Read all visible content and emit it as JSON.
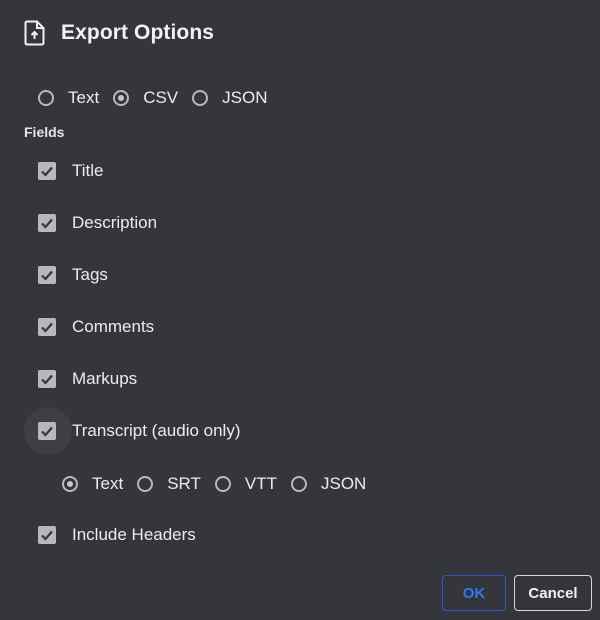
{
  "dialog": {
    "title": "Export Options",
    "title_icon": "file-upload-icon"
  },
  "format": {
    "options": [
      "Text",
      "CSV",
      "JSON"
    ],
    "selected": "CSV"
  },
  "fields": {
    "section_label": "Fields",
    "items": [
      {
        "label": "Title",
        "checked": true
      },
      {
        "label": "Description",
        "checked": true
      },
      {
        "label": "Tags",
        "checked": true
      },
      {
        "label": "Comments",
        "checked": true
      },
      {
        "label": "Markups",
        "checked": true
      },
      {
        "label": "Transcript (audio only)",
        "checked": true
      }
    ]
  },
  "transcript_format": {
    "options": [
      "Text",
      "SRT",
      "VTT",
      "JSON"
    ],
    "selected": "Text"
  },
  "include_headers": {
    "label": "Include Headers",
    "checked": true
  },
  "buttons": {
    "ok": "OK",
    "cancel": "Cancel"
  },
  "colors": {
    "background": "#35363b",
    "ok_accent": "#2f77ff",
    "checkbox_fill": "#b8b8bc"
  }
}
